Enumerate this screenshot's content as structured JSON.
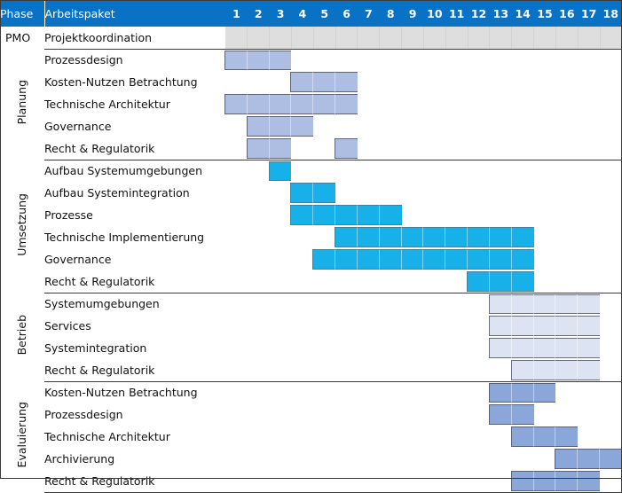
{
  "header": {
    "phase_label": "Phase",
    "workpackage_label": "Arbeitspaket",
    "timeline_units": [
      "1",
      "2",
      "3",
      "4",
      "5",
      "6",
      "7",
      "8",
      "9",
      "10",
      "11",
      "12",
      "13",
      "14",
      "15",
      "16",
      "17",
      "18"
    ]
  },
  "colors": {
    "header_bg": "#0a72c4",
    "header_text": "#ffffff",
    "pmo_band": "#dedede",
    "planung_bar": "#aebee2",
    "umsetzung_bar": "#18b0e9",
    "betrieb_bar": "#dce3f2",
    "evaluierung_bar": "#8ba6d8",
    "grid_line": "#9b9b9b",
    "frame_line": "#3a3a3a"
  },
  "chart_data": {
    "type": "bar",
    "title": "",
    "xlabel": "",
    "ylabel": "",
    "categories": [
      "1",
      "2",
      "3",
      "4",
      "5",
      "6",
      "7",
      "8",
      "9",
      "10",
      "11",
      "12",
      "13",
      "14",
      "15",
      "16",
      "17",
      "18"
    ],
    "axis_range": [
      1,
      18
    ],
    "grid": true,
    "legend": "none",
    "groups": [
      {
        "phase": "PMO",
        "phase_orientation": "horizontal",
        "bar_style": "pmo-band",
        "tasks": [
          {
            "name": "Projektkoordination",
            "start": 1,
            "end": 18,
            "style": "band"
          }
        ]
      },
      {
        "phase": "Planung",
        "phase_orientation": "vertical",
        "bar_style": "planung",
        "tasks": [
          {
            "name": "Prozessdesign",
            "start": 1,
            "end": 3
          },
          {
            "name": "Kosten-Nutzen Betrachtung",
            "start": 4,
            "end": 6
          },
          {
            "name": "Technische Architektur",
            "start": 1,
            "end": 6
          },
          {
            "name": "Governance",
            "start": 2,
            "end": 4
          },
          {
            "name": "Recht & Regulatorik",
            "start": 2,
            "end": 3,
            "extra": [
              {
                "start": 6,
                "end": 6
              }
            ]
          }
        ]
      },
      {
        "phase": "Umsetzung",
        "phase_orientation": "vertical",
        "bar_style": "umsetzung",
        "tasks": [
          {
            "name": "Aufbau Systemumgebungen",
            "start": 3,
            "end": 3
          },
          {
            "name": "Aufbau Systemintegration",
            "start": 4,
            "end": 5
          },
          {
            "name": "Prozesse",
            "start": 4,
            "end": 8
          },
          {
            "name": "Technische Implementierung",
            "start": 6,
            "end": 14
          },
          {
            "name": "Governance",
            "start": 5,
            "end": 14
          },
          {
            "name": "Recht & Regulatorik",
            "start": 12,
            "end": 14
          }
        ]
      },
      {
        "phase": "Betrieb",
        "phase_orientation": "vertical",
        "bar_style": "betrieb",
        "tasks": [
          {
            "name": "Systemumgebungen",
            "start": 13,
            "end": 17
          },
          {
            "name": "Services",
            "start": 13,
            "end": 17
          },
          {
            "name": "Systemintegration",
            "start": 13,
            "end": 17
          },
          {
            "name": "Recht & Regulatorik",
            "start": 14,
            "end": 17
          }
        ]
      },
      {
        "phase": "Evaluierung",
        "phase_orientation": "vertical",
        "bar_style": "evaluierung",
        "tasks": [
          {
            "name": "Kosten-Nutzen Betrachtung",
            "start": 13,
            "end": 15
          },
          {
            "name": "Prozessdesign",
            "start": 13,
            "end": 14
          },
          {
            "name": "Technische Architektur",
            "start": 14,
            "end": 16
          },
          {
            "name": "Archivierung",
            "start": 16,
            "end": 18
          },
          {
            "name": "Recht & Regulatorik",
            "start": 14,
            "end": 17
          }
        ]
      }
    ]
  }
}
